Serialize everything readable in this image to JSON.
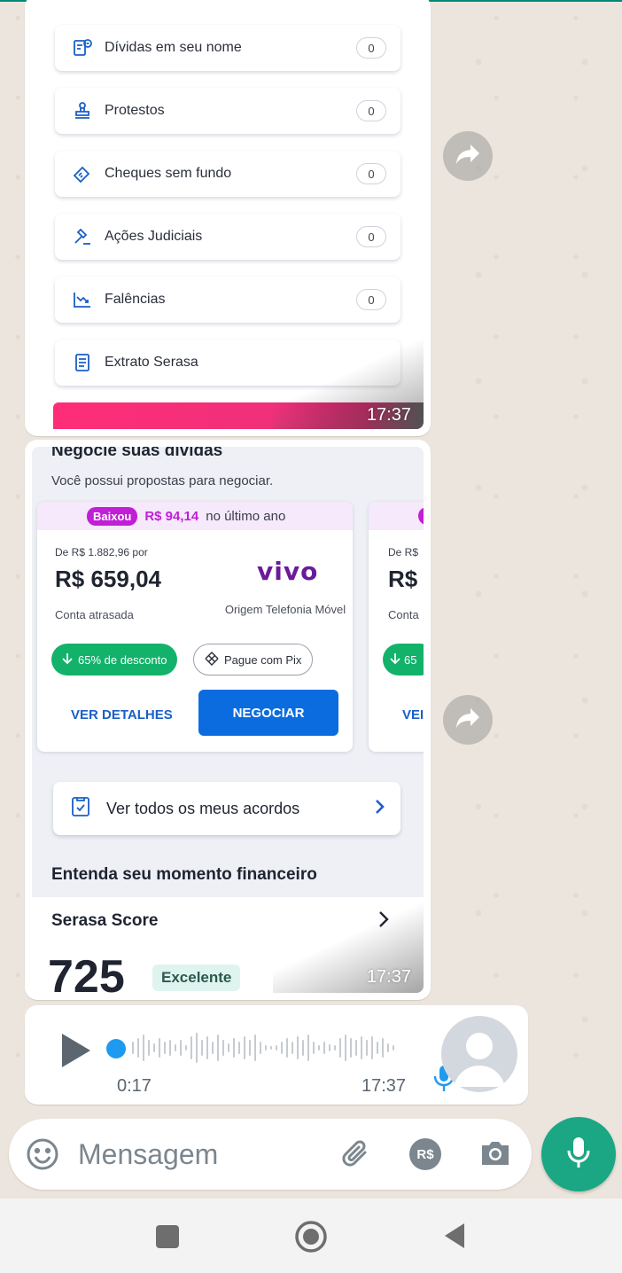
{
  "report_items": [
    {
      "label": "Dívidas em seu nome",
      "count": "0",
      "icon": "debt-document-icon"
    },
    {
      "label": "Protestos",
      "count": "0",
      "icon": "stamp-icon"
    },
    {
      "label": "Cheques sem fundo",
      "count": "0",
      "icon": "check-icon"
    },
    {
      "label": "Ações Judiciais",
      "count": "0",
      "icon": "gavel-icon"
    },
    {
      "label": "Falências",
      "count": "0",
      "icon": "chart-down-icon"
    },
    {
      "label": "Extrato Serasa",
      "icon": "statement-icon"
    }
  ],
  "bubble1_time": "17:37",
  "negotiation": {
    "title": "Negocie suas dívidas",
    "subtitle": "Você possui propostas para negociar.",
    "offer": {
      "badge": "Baixou",
      "drop_value": "R$ 94,14",
      "drop_text": "no último ano",
      "original": "De R$ 1.882,96 por",
      "price": "R$ 659,04",
      "status": "Conta atrasada",
      "brand": "vivo",
      "origin": "Origem Telefonia Móvel",
      "discount": "65% de desconto",
      "pix": "Pague com Pix",
      "details": "VER DETALHES",
      "negotiate": "NEGOCIAR"
    },
    "offer2_partial": {
      "original": "De R$",
      "price": "R$",
      "status": "Conta",
      "discount": "65",
      "details": "VEI"
    },
    "agreements": "Ver todos os meus acordos",
    "section_title": "Entenda seu momento financeiro",
    "score_label": "Serasa Score",
    "score_value": "725",
    "score_tag": "Excelente",
    "time": "17:37"
  },
  "audio": {
    "duration": "0:17",
    "time": "17:37",
    "progress": 0
  },
  "composer": {
    "placeholder": "Mensagem",
    "pay_label": "R$"
  },
  "colors": {
    "whatsapp_green": "#1ba784",
    "serasa_blue": "#0b6ce0",
    "offer_magenta": "#c11fd6",
    "discount_green": "#12b26b"
  }
}
